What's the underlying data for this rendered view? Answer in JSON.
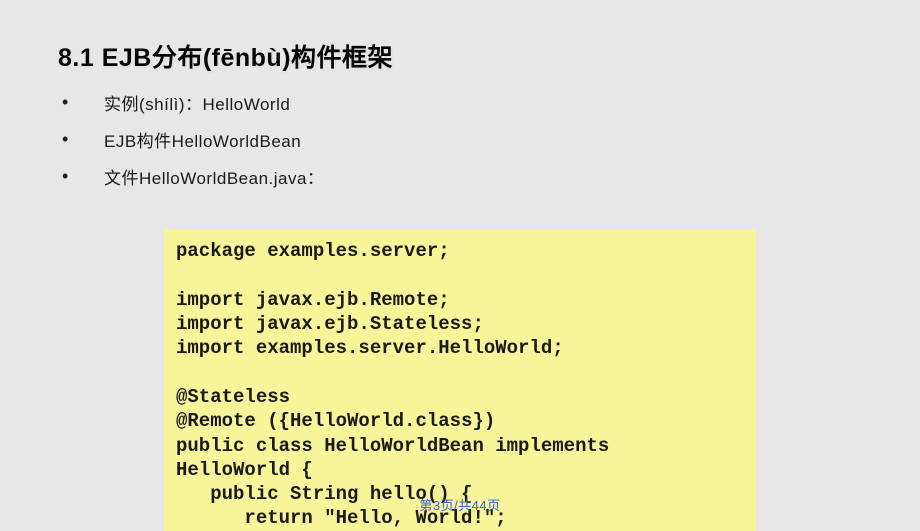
{
  "heading": "8.1 EJB分布(fēnbù)构件框架",
  "bullets": [
    "实例(shílì)：HelloWorld",
    "EJB构件HelloWorldBean",
    "文件HelloWorldBean.java："
  ],
  "code": "package examples.server;\n\nimport javax.ejb.Remote;\nimport javax.ejb.Stateless;\nimport examples.server.HelloWorld;\n\n@Stateless\n@Remote ({HelloWorld.class})\npublic class HelloWorldBean implements\nHelloWorld {\n   public String hello() {\n      return \"Hello, World!\";",
  "pagenum": "第3页/共44页"
}
